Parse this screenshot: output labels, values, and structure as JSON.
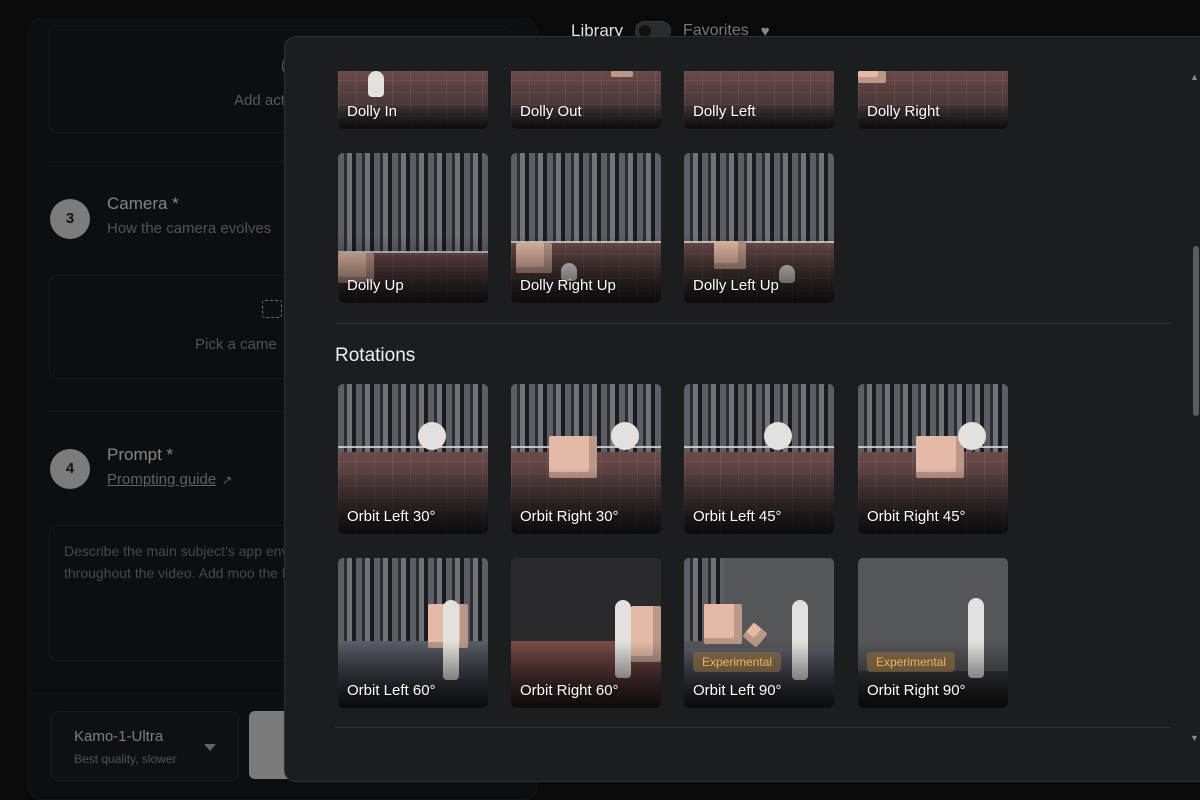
{
  "background": {
    "add_box_label": "Add actin",
    "camera_step": {
      "number": "3",
      "title": "Camera *",
      "subtitle": "How the camera evolves",
      "picker_label": "Pick a came"
    },
    "prompt_step": {
      "number": "4",
      "title": "Prompt *",
      "link": "Prompting guide"
    },
    "prompt_placeholder": "Describe the main subject's app environment around them and h throughout the video. Add moo the final look.",
    "model": {
      "name": "Kamo-1-Ultra",
      "description": "Best quality, slower"
    }
  },
  "library": {
    "title": "Library",
    "favorites_label": "Favorites",
    "favorites_on": false
  },
  "modal": {
    "translations_row1": [
      {
        "label": "Dolly In"
      },
      {
        "label": "Dolly Out"
      },
      {
        "label": "Dolly Left"
      },
      {
        "label": "Dolly Right"
      }
    ],
    "translations_row2": [
      {
        "label": "Dolly Up"
      },
      {
        "label": "Dolly Right Up"
      },
      {
        "label": "Dolly Left Up"
      }
    ],
    "rotations_title": "Rotations",
    "rotations_row1": [
      {
        "label": "Orbit Left 30°"
      },
      {
        "label": "Orbit Right 30°"
      },
      {
        "label": "Orbit Left 45°"
      },
      {
        "label": "Orbit Right 45°"
      }
    ],
    "rotations_row2": [
      {
        "label": "Orbit Left 60°",
        "badge": ""
      },
      {
        "label": "Orbit Right 60°",
        "badge": ""
      },
      {
        "label": "Orbit Left 90°",
        "badge": "Experimental"
      },
      {
        "label": "Orbit Right 90°",
        "badge": "Experimental"
      }
    ]
  },
  "colors": {
    "modal_bg": "#1c1d1f",
    "badge_text": "#f0b45a",
    "accent_box": "#e4b9a6"
  }
}
